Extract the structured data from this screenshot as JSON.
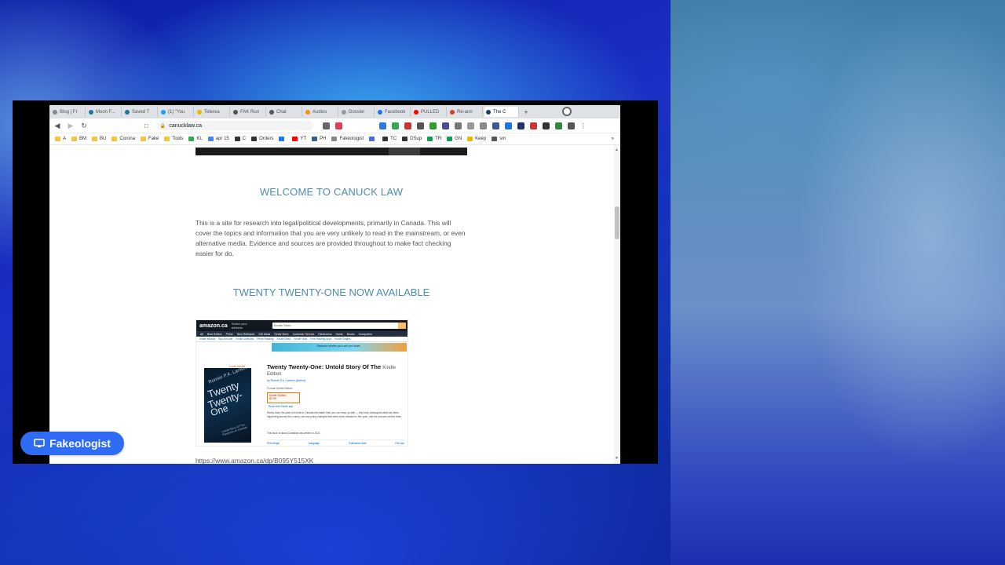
{
  "browser": {
    "tabs": [
      {
        "label": "Blog | Fr",
        "color": "#888888"
      },
      {
        "label": "Moon F...",
        "color": "#21759b"
      },
      {
        "label": "Saved T",
        "color": "#21759b"
      },
      {
        "label": "(1) \"You",
        "color": "#1da1f2"
      },
      {
        "label": "Telerea",
        "color": "#f5b400"
      },
      {
        "label": "FAK Run",
        "color": "#555555"
      },
      {
        "label": "Chat",
        "color": "#555555"
      },
      {
        "label": "Audios",
        "color": "#f29111"
      },
      {
        "label": "Dossier",
        "color": "#999999"
      },
      {
        "label": "Facebook",
        "color": "#1877f2"
      },
      {
        "label": "PULLED",
        "color": "#ff0000"
      },
      {
        "label": "Re-ann",
        "color": "#cc4422"
      },
      {
        "label": "The C",
        "color": "#1e3c72"
      }
    ],
    "new_tab_symbol": "+",
    "url": "canucklaw.ca",
    "bookmarks": [
      {
        "label": "A",
        "color": "#f4c542"
      },
      {
        "label": "BM",
        "color": "#f4c542"
      },
      {
        "label": "BU",
        "color": "#f4c542"
      },
      {
        "label": "Corona",
        "color": "#f4c542"
      },
      {
        "label": "Fake",
        "color": "#f4c542"
      },
      {
        "label": "Tools",
        "color": "#f4c542"
      },
      {
        "label": "KL",
        "color": "#34a853"
      },
      {
        "label": "apr 15",
        "color": "#4285f4"
      },
      {
        "label": "C",
        "color": "#333333"
      },
      {
        "label": "Orders",
        "color": "#333333"
      },
      {
        "label": "",
        "color": "#1877f2"
      },
      {
        "label": "YT",
        "color": "#ff0000"
      },
      {
        "label": "PH",
        "color": "#3b5998"
      },
      {
        "label": "Fakeologist",
        "color": "#888888"
      },
      {
        "label": "",
        "color": "#4a6bd8"
      },
      {
        "label": "TC",
        "color": "#333333"
      },
      {
        "label": "DSup",
        "color": "#333333"
      },
      {
        "label": "TR",
        "color": "#0f9d58"
      },
      {
        "label": "GN",
        "color": "#0f9d58"
      },
      {
        "label": "Keep",
        "color": "#f4b400"
      },
      {
        "label": "sm",
        "color": "#555555"
      }
    ],
    "bookmarks_overflow": "»"
  },
  "page": {
    "welcome_title": "WELCOME TO CANUCK LAW",
    "intro_text": "This is a site for research into legal/political developments, primarily in Canada. This will cover the topics and information that you are very unlikely to read in the mainstream, or even alternative media. Evidence and sources are provided throughout to make fact checking easier for do.",
    "section_title": "TWENTY TWENTY-ONE NOW AVAILABLE",
    "amazon_url": "https://www.amazon.ca/dp/B095Y515XK"
  },
  "amazon": {
    "logo": "amazon.ca",
    "address": "Select your address",
    "search_value": "Kindle Store",
    "nav_items": [
      "All",
      "Best Sellers",
      "Prime",
      "New Releases",
      "Gift Ideas",
      "Deals Store",
      "Customer Service",
      "Electronics",
      "Home",
      "Books",
      "Computers"
    ],
    "sub_items": [
      "Kindle eBooks",
      "Buy A Kindle",
      "Kindle Unlimited",
      "Prime Reading",
      "Kindle Deals",
      "Kindle Vella",
      "Free Reading Apps",
      "Kindle Singles"
    ],
    "banner_text": "Discover stories you can't put down",
    "look_inside": "Look inside",
    "book_author": "Ronnie P.A. Lamuro",
    "book_title_lines": [
      "Twenty",
      "Twenty-",
      "One"
    ],
    "book_subtitle": "Untold Story Of The Pandemic In Canada",
    "title": "Twenty Twenty-One: Untold Story Of The",
    "title_suffix": "Kindle",
    "edition": "Edition",
    "byline": "by Ronnie P.A. Lamuro (Author)",
    "format": "Format: Kindle Edition",
    "price_label": "Kindle Edition",
    "price": "$2.99",
    "read_with": "Read with Kindle app",
    "description": "Rarely does the pace of events in Canada rise faster than you can keep up with — this book catalogues what has been happening across the country, law and policy changes that were never debated in the open, and the sources behind them.",
    "note": "This book is about Canadian law written in 2021.",
    "links": [
      "Print length",
      "Language",
      "Publication date",
      "File size"
    ]
  },
  "overlay": {
    "badge_label": "Fakeologist"
  },
  "colors": {
    "heading": "#4a8db0",
    "badge": "#2f6cf3",
    "amazon_dark": "#131921"
  }
}
